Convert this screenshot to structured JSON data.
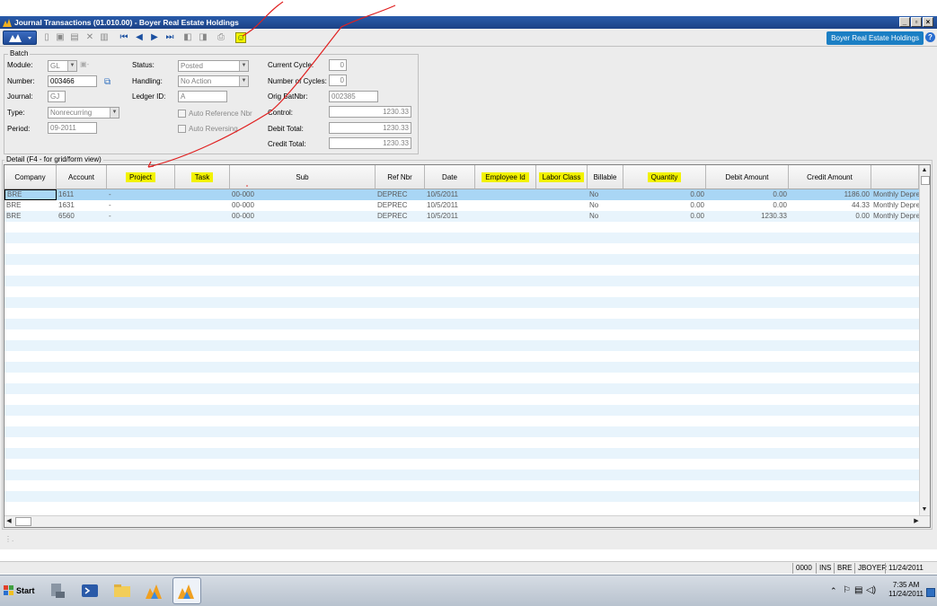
{
  "window": {
    "title": "Journal Transactions (01.010.00) - Boyer Real Estate Holdings",
    "min": "_",
    "max": "▫",
    "close": "×"
  },
  "toolbar": {
    "company": "Boyer Real Estate Holdings",
    "help": "?"
  },
  "batch": {
    "group_label": "Batch",
    "module_label": "Module:",
    "module_value": "GL",
    "number_label": "Number:",
    "number_value": "003466",
    "journal_label": "Journal:",
    "journal_value": "GJ",
    "type_label": "Type:",
    "type_value": "Nonrecurring",
    "period_label": "Period:",
    "period_value": "09-2011",
    "status_label": "Status:",
    "status_value": "Posted",
    "handling_label": "Handling:",
    "handling_value": "No Action",
    "ledger_label": "Ledger ID:",
    "ledger_value": "A",
    "auto_ref_label": "Auto Reference Nbr",
    "auto_rev_label": "Auto Reversing",
    "current_cycle_label": "Current Cycle:",
    "current_cycle_value": "0",
    "num_cycles_label": "Number of Cycles:",
    "num_cycles_value": "0",
    "orig_batnbr_label": "Orig BatNbr:",
    "orig_batnbr_value": "002385",
    "control_label": "Control:",
    "control_value": "1230.33",
    "debit_total_label": "Debit Total:",
    "debit_total_value": "1230.33",
    "credit_total_label": "Credit Total:",
    "credit_total_value": "1230.33"
  },
  "detail": {
    "group_label": "Detail (F4 - for grid/form view)",
    "columns": [
      "Company",
      "Account",
      "Project",
      "Task",
      "Sub",
      "Ref Nbr",
      "Date",
      "Employee Id",
      "Labor Class",
      "Billable",
      "Quantity",
      "Debit Amount",
      "Credit Amount"
    ],
    "rows": [
      {
        "company": "BRE",
        "account": "1611",
        "project": "-",
        "task": "",
        "sub": "00-000",
        "refnbr": "DEPREC",
        "date": "10/5/2011",
        "employee": "",
        "labor": "",
        "billable": "No",
        "quantity": "0.00",
        "debit": "0.00",
        "credit": "1186.00",
        "desc": "Monthly Deprec"
      },
      {
        "company": "BRE",
        "account": "1631",
        "project": "-",
        "task": "",
        "sub": "00-000",
        "refnbr": "DEPREC",
        "date": "10/5/2011",
        "employee": "",
        "labor": "",
        "billable": "No",
        "quantity": "0.00",
        "debit": "0.00",
        "credit": "44.33",
        "desc": "Monthly Deprec"
      },
      {
        "company": "BRE",
        "account": "6560",
        "project": "-",
        "task": "",
        "sub": "00-000",
        "refnbr": "DEPREC",
        "date": "10/5/2011",
        "employee": "",
        "labor": "",
        "billable": "No",
        "quantity": "0.00",
        "debit": "1230.33",
        "credit": "0.00",
        "desc": "Monthly Deprec"
      }
    ]
  },
  "status_bar": [
    "0000",
    "INS",
    "BRE",
    "JBOYER",
    "11/24/2011"
  ],
  "taskbar": {
    "start": "Start",
    "time": "7:35 AM",
    "date": "11/24/2011"
  },
  "colors": {
    "title_bar": "#1c4186",
    "highlight": "#f2f200",
    "selected_row": "#a9d6f5",
    "annotation": "#e02020",
    "company_badge": "#1b7fc4"
  }
}
